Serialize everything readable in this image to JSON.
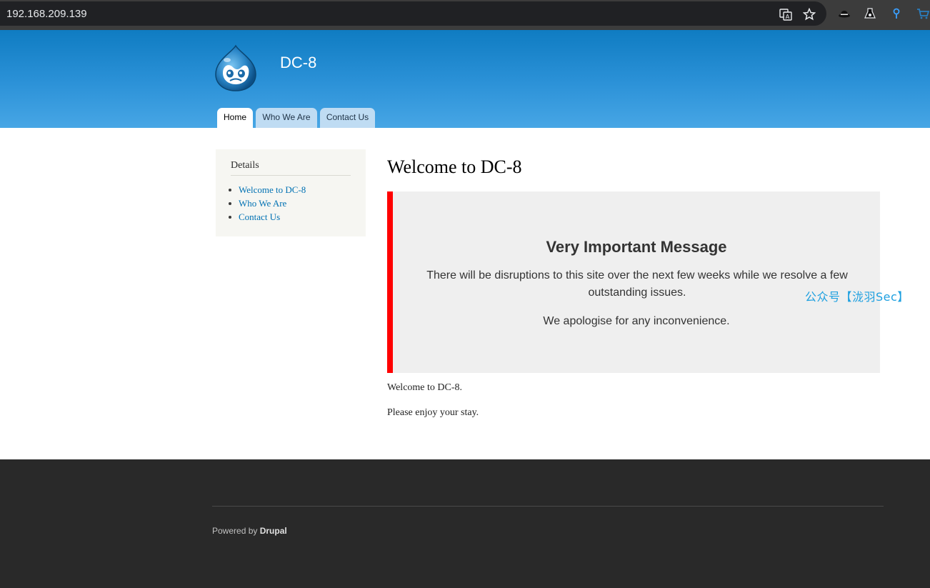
{
  "browser": {
    "url": "192.168.209.139",
    "icons": [
      "translate-icon",
      "star-icon",
      "hat-extension-icon",
      "flask-extension-icon",
      "pin-extension-icon",
      "cart-extension-icon"
    ]
  },
  "header": {
    "site_name": "DC-8",
    "logo": "drupal-drop-logo",
    "tabs": [
      {
        "label": "Home",
        "active": true
      },
      {
        "label": "Who We Are",
        "active": false
      },
      {
        "label": "Contact Us",
        "active": false
      }
    ]
  },
  "sidebar": {
    "title": "Details",
    "links": [
      "Welcome to DC-8",
      "Who We Are",
      "Contact Us"
    ]
  },
  "main": {
    "title": "Welcome to DC-8",
    "notice": {
      "heading": "Very Important Message",
      "body": "There will be disruptions to this site over the next few weeks while we resolve a few outstanding issues.",
      "apology": "We apologise for any inconvenience."
    },
    "paragraphs": [
      "Welcome to DC-8.",
      "Please enjoy your stay."
    ]
  },
  "watermark": "公众号【泷羽Sec】",
  "footer": {
    "powered_prefix": "Powered by",
    "powered_link": "Drupal"
  },
  "colors": {
    "header_top": "#0f7cc2",
    "header_bottom": "#47a6e5",
    "link": "#0071b3",
    "notice_border": "#ff0000",
    "footer_bg": "#292929"
  }
}
